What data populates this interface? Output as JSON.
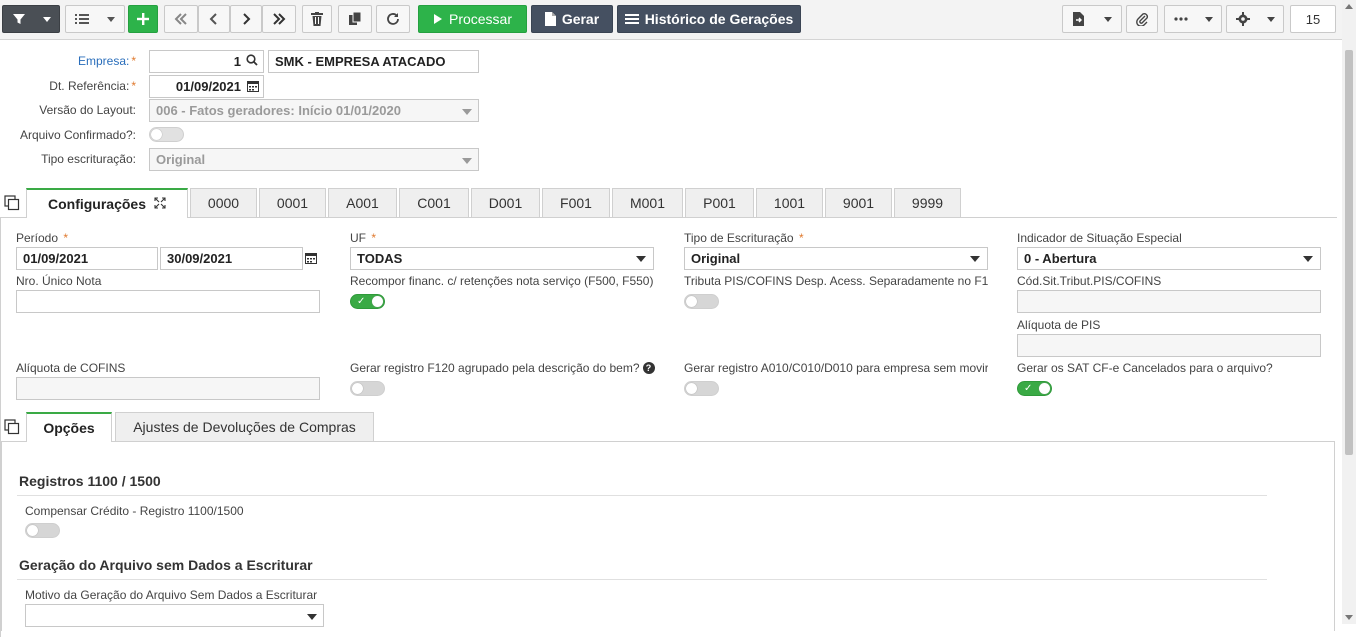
{
  "toolbar": {
    "filter_icon": "filter-icon",
    "processar_label": "Processar",
    "gerar_label": "Gerar",
    "historico_label": "Histórico de Gerações",
    "page_count": "15"
  },
  "header": {
    "empresa_label": "Empresa:",
    "empresa_code": "1",
    "empresa_name": "SMK - EMPRESA ATACADO",
    "dt_ref_label": "Dt. Referência:",
    "dt_ref_value": "01/09/2021",
    "versao_label": "Versão do Layout:",
    "versao_value": "006 - Fatos geradores: Início 01/01/2020",
    "arquivo_label": "Arquivo Confirmado?:",
    "tipo_label": "Tipo escrituração:",
    "tipo_value": "Original"
  },
  "tabs": [
    {
      "label": "Configurações"
    },
    {
      "label": "0000"
    },
    {
      "label": "0001"
    },
    {
      "label": "A001"
    },
    {
      "label": "C001"
    },
    {
      "label": "D001"
    },
    {
      "label": "F001"
    },
    {
      "label": "M001"
    },
    {
      "label": "P001"
    },
    {
      "label": "1001"
    },
    {
      "label": "9001"
    },
    {
      "label": "9999"
    }
  ],
  "config": {
    "periodo_label": "Período",
    "periodo_start": "01/09/2021",
    "periodo_end": "30/09/2021",
    "uf_label": "UF",
    "uf_value": "TODAS",
    "tipo_escr_label": "Tipo de Escrituração",
    "tipo_escr_value": "Original",
    "indicador_label": "Indicador de Situação Especial",
    "indicador_value": "0 - Abertura",
    "nro_unico_label": "Nro. Único Nota",
    "recompor_label": "Recompor financ. c/ retenções nota serviço (F500, F550)",
    "tributa_label": "Tributa PIS/COFINS Desp. Acess. Separadamente no F1",
    "cod_sit_label": "Cód.Sit.Tribut.PIS/COFINS",
    "aliq_pis_label": "Alíquota de PIS",
    "aliq_cofins_label": "Alíquota de COFINS",
    "gerar_f120_label": "Gerar registro F120 agrupado pela descrição do bem?",
    "gerar_a010_label": "Gerar registro A010/C010/D010 para empresa sem movir",
    "gerar_sat_label": "Gerar os SAT CF-e Cancelados para o arquivo?"
  },
  "subtabs": [
    {
      "label": "Opções"
    },
    {
      "label": "Ajustes de Devoluções de Compras"
    }
  ],
  "opcoes": {
    "sec1_title": "Registros 1100 / 1500",
    "compensar_label": "Compensar Crédito - Registro 1100/1500",
    "sec2_title": "Geração do Arquivo sem Dados a Escriturar",
    "motivo_label": "Motivo da Geração do Arquivo Sem Dados a Escriturar"
  }
}
